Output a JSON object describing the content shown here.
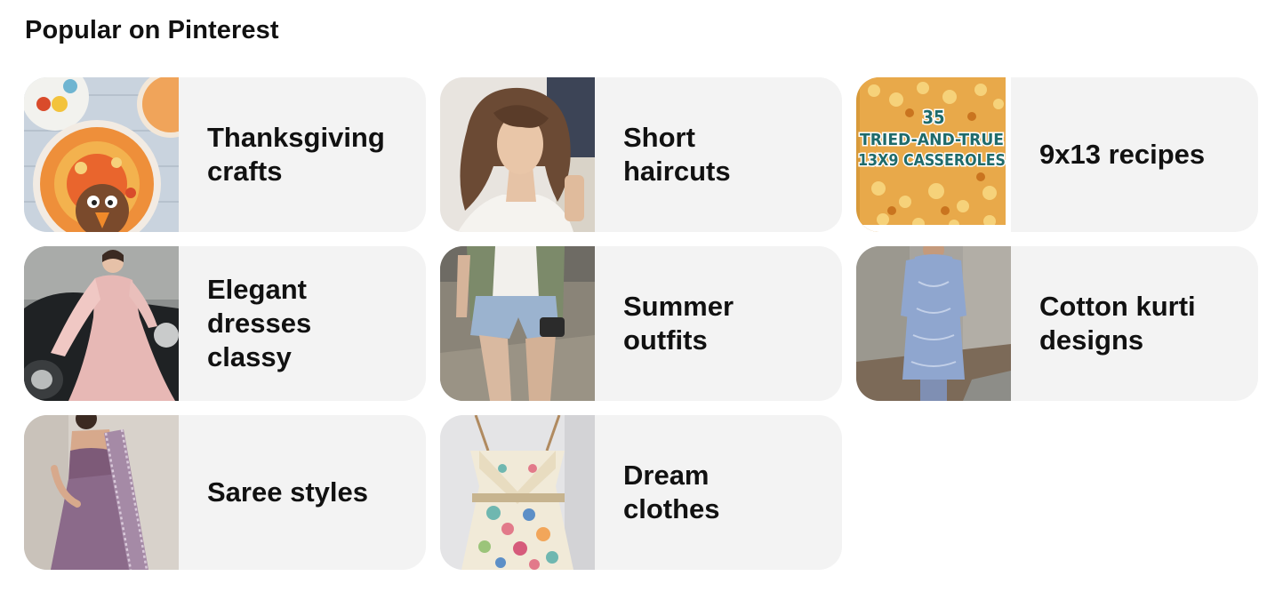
{
  "section": {
    "title": "Popular on Pinterest"
  },
  "cards": [
    {
      "label_lines": [
        "Thanksgiving",
        "crafts"
      ],
      "thumb": "turkey-craft-image"
    },
    {
      "label_lines": [
        "Short",
        "haircuts"
      ],
      "thumb": "short-haircut-image"
    },
    {
      "label_lines": [
        "9x13 recipes"
      ],
      "thumb": "casserole-image",
      "thumb_text": [
        "35",
        "TRIED-AND-TRUE",
        "13X9 CASSEROLES"
      ]
    },
    {
      "label_lines": [
        "Elegant",
        "dresses",
        "classy"
      ],
      "thumb": "pink-dress-image"
    },
    {
      "label_lines": [
        "Summer",
        "outfits"
      ],
      "thumb": "summer-outfit-image"
    },
    {
      "label_lines": [
        "Cotton kurti",
        "designs"
      ],
      "thumb": "kurti-image"
    },
    {
      "label_lines": [
        "Saree styles"
      ],
      "thumb": "saree-image"
    },
    {
      "label_lines": [
        "Dream",
        "clothes"
      ],
      "thumb": "floral-dress-image"
    }
  ]
}
